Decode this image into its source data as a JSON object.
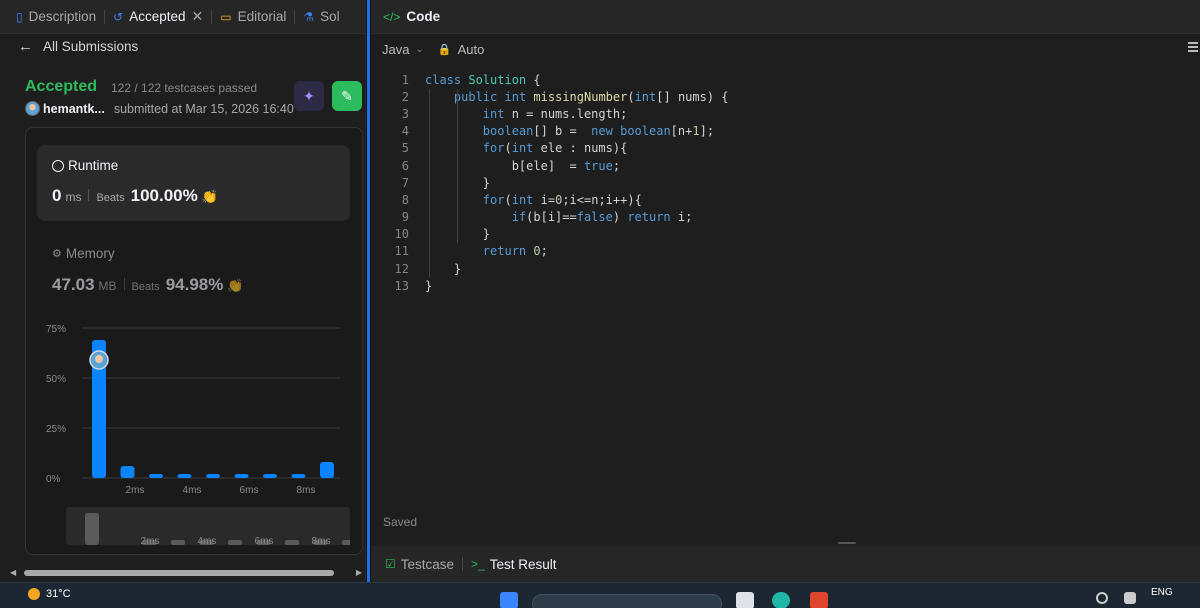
{
  "left_tabs": [
    {
      "label": "Description",
      "icon": "document-icon"
    },
    {
      "label": "Accepted",
      "icon": "history-icon"
    },
    {
      "label": "Editorial",
      "icon": "book-icon"
    },
    {
      "label": "Sol",
      "icon": "flask-icon"
    }
  ],
  "back_label": "All Submissions",
  "submission": {
    "status": "Accepted",
    "testcases": "122 / 122 testcases passed",
    "username": "hemantk...",
    "submitted": "submitted at Mar 15, 2026 16:40"
  },
  "runtime": {
    "label": "Runtime",
    "value": "0",
    "unit": "ms",
    "beats_label": "Beats",
    "beats_pct": "100.00%"
  },
  "memory": {
    "label": "Memory",
    "value": "47.03",
    "unit": "MB",
    "beats_label": "Beats",
    "beats_pct": "94.98%"
  },
  "chart_data": {
    "type": "bar",
    "y_ticks": [
      "75%",
      "50%",
      "25%",
      "0%"
    ],
    "x_ticks": [
      "2ms",
      "4ms",
      "6ms",
      "8ms"
    ],
    "ylim": [
      0,
      75
    ],
    "values": [
      69,
      6,
      2,
      2,
      2,
      2,
      2,
      2,
      8
    ],
    "accent": "#0a84ff",
    "grid": true
  },
  "mini_chart": {
    "x_ticks": [
      "2ms",
      "4ms",
      "6ms",
      "8ms"
    ]
  },
  "code_panel": {
    "title": "Code",
    "language": "Java",
    "mode": "Auto",
    "status": "Saved"
  },
  "code_lines": [
    "class Solution {",
    "    public int missingNumber(int[] nums) {",
    "        int n = nums.length;",
    "        boolean[] b =  new boolean[n+1];",
    "        for(int ele : nums){",
    "            b[ele]  = true;",
    "        }",
    "        for(int i=0;i<=n;i++){",
    "            if(b[i]==false) return i;",
    "        }",
    "        return 0;",
    "    }",
    "}"
  ],
  "bottom_tabs": [
    {
      "label": "Testcase",
      "icon": "checkbox-icon"
    },
    {
      "label": "Test Result",
      "icon": "terminal-icon"
    }
  ],
  "taskbar": {
    "temperature": "31°C",
    "language": "ENG"
  },
  "colors": {
    "accepted_green": "#2cbb5d",
    "divider_blue": "#1a73e8"
  }
}
